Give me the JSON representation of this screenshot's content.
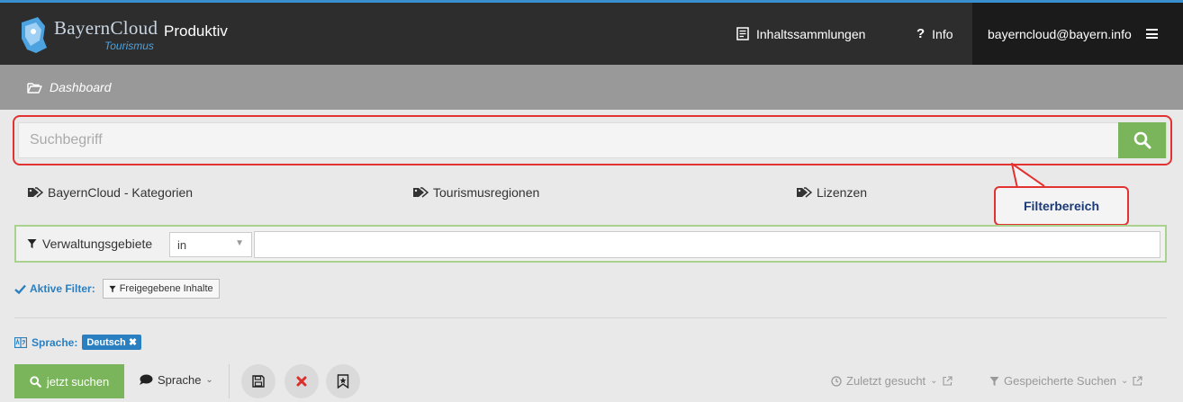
{
  "header": {
    "brand": "BayernCloud",
    "brand_sub": "Tourismus",
    "environment": "Produktiv",
    "collections_label": "Inhaltssammlungen",
    "info_label": "Info",
    "user_email": "bayerncloud@bayern.info"
  },
  "breadcrumb": {
    "label": "Dashboard"
  },
  "search": {
    "placeholder": "Suchbegriff"
  },
  "callout": {
    "label": "Filterbereich"
  },
  "categories": [
    {
      "label": "BayernCloud - Kategorien"
    },
    {
      "label": "Tourismusregionen"
    },
    {
      "label": "Lizenzen"
    }
  ],
  "filter": {
    "field_label": "Verwaltungsgebiete",
    "operator": "in",
    "value": ""
  },
  "active_filters": {
    "label": "Aktive Filter:",
    "items": [
      {
        "label": "Freigegebene Inhalte"
      }
    ]
  },
  "language": {
    "label": "Sprache:",
    "selected": "Deutsch"
  },
  "actions": {
    "search_button": "jetzt suchen",
    "language_dropdown": "Sprache",
    "recent_searches": "Zuletzt gesucht",
    "saved_searches": "Gespeicherte Suchen"
  },
  "colors": {
    "accent_green": "#7ab55c",
    "accent_blue": "#2a7fc1",
    "highlight_red": "#e23232",
    "topbar": "#2d2d2d"
  }
}
